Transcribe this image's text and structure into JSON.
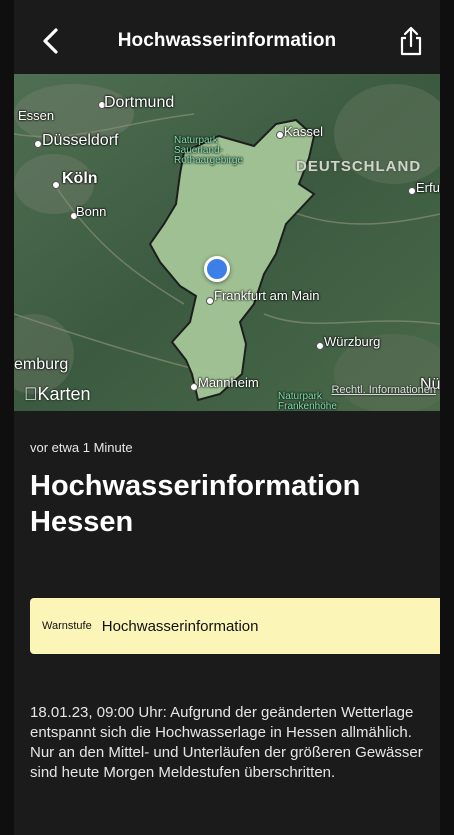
{
  "nav": {
    "title": "Hochwasserinformation",
    "back_icon": "chevron-left-icon",
    "share_icon": "share-icon"
  },
  "map": {
    "cities": {
      "dortmund": "Dortmund",
      "essen": "Essen",
      "duesseldorf": "Düsseldorf",
      "koeln": "Köln",
      "bonn": "Bonn",
      "kassel": "Kassel",
      "erfurt": "Erfurt",
      "frankfurt": "Frankfurt am Main",
      "wuerzburg": "Würzburg",
      "mannheim": "Mannheim",
      "hamburg_partial": "emburg",
      "nuernberg_partial": "Nürr"
    },
    "park_top": "Naturpark Sauerland-Rothaargebirge",
    "park_bottom": "Naturpark Frankenhöhe",
    "country": "DEUTSCHLAND",
    "maps_brand": "Karten",
    "legal": "Rechtl. Informationen",
    "accent": "#3d7fe8",
    "region_fill": "#a8c99a"
  },
  "content": {
    "time": "vor etwa 1 Minute",
    "headline": "Hochwasserinformation Hessen",
    "warn_label": "Warnstufe",
    "warn_value": "Hochwasserinformation",
    "warn_color": "#fbf6b8",
    "body": "18.01.23, 09:00 Uhr: Aufgrund der geänderten Wetterlage entspannt sich die Hochwasserlage in Hessen allmählich. Nur an den Mittel- und Unterläufen der größeren Gewässer sind heute Morgen Meldestufen überschritten."
  }
}
